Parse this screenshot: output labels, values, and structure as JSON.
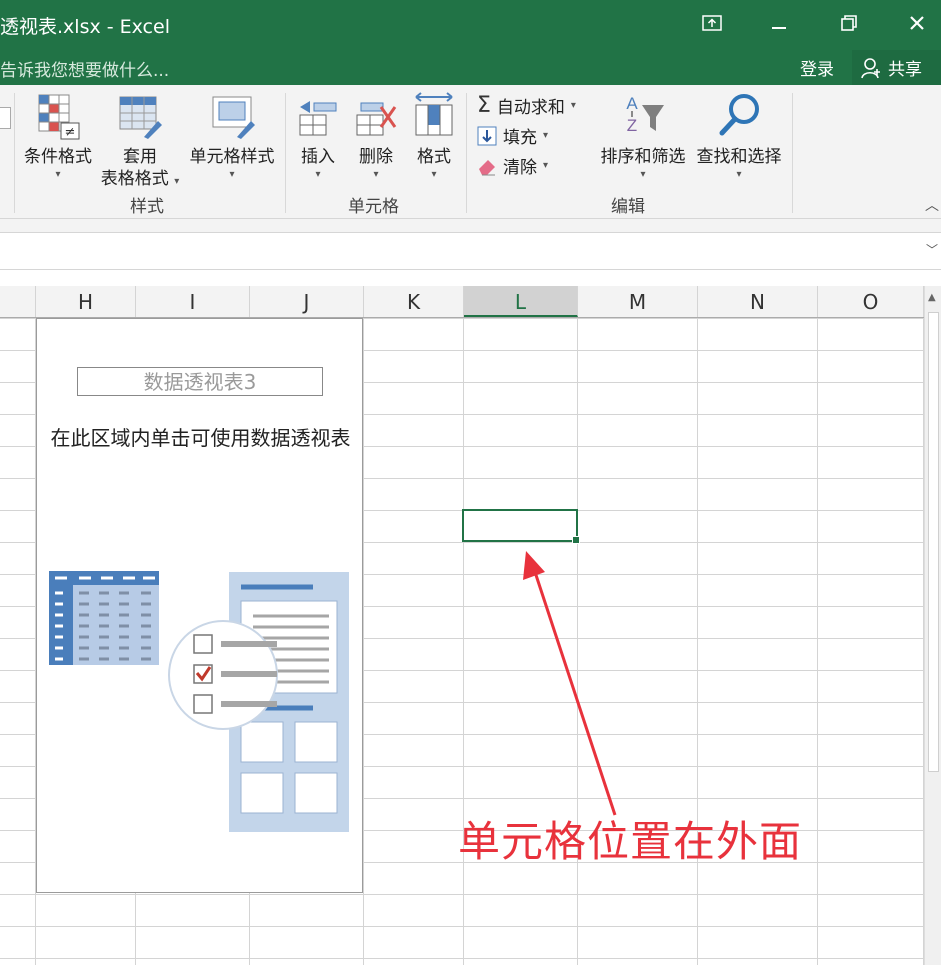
{
  "window": {
    "title": "透视表.xlsx - Excel",
    "tell_me": "告诉我您想要做什么...",
    "login": "登录",
    "share": "共享"
  },
  "ribbon": {
    "styles": {
      "conditional_format": "条件格式",
      "format_table_line1": "套用",
      "format_table_line2": "表格格式",
      "cell_styles": "单元格样式",
      "group": "样式"
    },
    "cells": {
      "insert": "插入",
      "delete": "删除",
      "format": "格式",
      "group": "单元格"
    },
    "editing": {
      "autosum": "自动求和",
      "fill": "填充",
      "clear": "清除",
      "sort_filter": "排序和筛选",
      "find_select": "查找和选择",
      "group": "编辑"
    }
  },
  "columns": [
    "H",
    "I",
    "J",
    "K",
    "L",
    "M",
    "N",
    "O"
  ],
  "selected_column": "L",
  "pivot": {
    "name": "数据透视表3",
    "hint": "在此区域内单击可使用数据透视表"
  },
  "annotation": "单元格位置在外面",
  "colors": {
    "title_bar": "#217346",
    "accent": "#217346",
    "annotation": "#e8323c"
  }
}
